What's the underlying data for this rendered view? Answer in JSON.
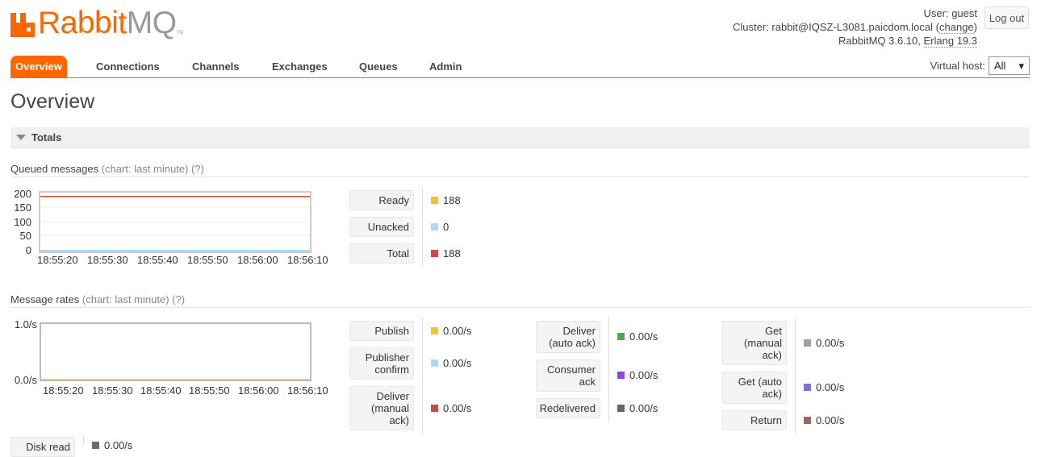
{
  "header": {
    "logo_rabbit": "Rabbit",
    "logo_mq": "MQ",
    "logo_tm": "TM",
    "user_label": "User:",
    "user_name": "guest",
    "cluster_label": "Cluster:",
    "cluster_name": "rabbit@IQSZ-L3081.paicdom.local",
    "cluster_open": "(",
    "cluster_change": "change",
    "cluster_close": ")",
    "rabbitmq_version": "RabbitMQ 3.6.10,",
    "erlang_version": "Erlang 19.3",
    "logout_label": "Log out"
  },
  "nav": {
    "tabs": [
      {
        "label": "Overview",
        "active": true
      },
      {
        "label": "Connections",
        "active": false
      },
      {
        "label": "Channels",
        "active": false
      },
      {
        "label": "Exchanges",
        "active": false
      },
      {
        "label": "Queues",
        "active": false
      },
      {
        "label": "Admin",
        "active": false
      }
    ],
    "vhost_label": "Virtual host:",
    "vhost_value": "All"
  },
  "page_title": "Overview",
  "section": {
    "title": "Totals"
  },
  "queued": {
    "title": "Queued messages",
    "note": "(chart: last minute) (?)",
    "legend": [
      {
        "label": "Ready",
        "value": "188",
        "color": "#edc240"
      },
      {
        "label": "Unacked",
        "value": "0",
        "color": "#afd8f8"
      },
      {
        "label": "Total",
        "value": "188",
        "color": "#cb4b4b"
      }
    ],
    "chart": {
      "y_ticks": [
        "200",
        "150",
        "100",
        "50",
        "0"
      ],
      "x_ticks": [
        "18:55:20",
        "18:55:30",
        "18:55:40",
        "18:55:50",
        "18:56:00",
        "18:56:10"
      ]
    }
  },
  "rates": {
    "title": "Message rates",
    "note": "(chart: last minute) (?)",
    "chart": {
      "y_ticks": [
        "1.0/s",
        "0.0/s"
      ],
      "x_ticks": [
        "18:55:20",
        "18:55:30",
        "18:55:40",
        "18:55:50",
        "18:56:00",
        "18:56:10"
      ]
    },
    "col1": [
      {
        "label": "Publish",
        "value": "0.00/s",
        "color": "#edc240"
      },
      {
        "label": "Publisher confirm",
        "value": "0.00/s",
        "color": "#afd8f8"
      },
      {
        "label": "Deliver (manual ack)",
        "value": "0.00/s",
        "color": "#cb4b4b"
      }
    ],
    "col2": [
      {
        "label": "Deliver (auto ack)",
        "value": "0.00/s",
        "color": "#4da74d"
      },
      {
        "label": "Consumer ack",
        "value": "0.00/s",
        "color": "#9440ed"
      },
      {
        "label": "Redelivered",
        "value": "0.00/s",
        "color": "#666666"
      }
    ],
    "col3": [
      {
        "label": "Get (manual ack)",
        "value": "0.00/s",
        "color": "#a0a0a0"
      },
      {
        "label": "Get (auto ack)",
        "value": "0.00/s",
        "color": "#7878c8"
      },
      {
        "label": "Return",
        "value": "0.00/s",
        "color": "#9c6464"
      }
    ],
    "bottom_partial": {
      "label": "Disk read",
      "value": "0.00/s",
      "color": "#5f6f7a"
    }
  },
  "chart_data": [
    {
      "type": "line",
      "title": "Queued messages",
      "ylim": [
        0,
        200
      ],
      "x": [
        "18:55:20",
        "18:55:30",
        "18:55:40",
        "18:55:50",
        "18:56:00",
        "18:56:10"
      ],
      "series": [
        {
          "name": "Ready",
          "values": [
            188,
            188,
            188,
            188,
            188,
            188
          ]
        },
        {
          "name": "Unacked",
          "values": [
            0,
            0,
            0,
            0,
            0,
            0
          ]
        },
        {
          "name": "Total",
          "values": [
            188,
            188,
            188,
            188,
            188,
            188
          ]
        }
      ]
    },
    {
      "type": "line",
      "title": "Message rates",
      "ylim": [
        0,
        1
      ],
      "x": [
        "18:55:20",
        "18:55:30",
        "18:55:40",
        "18:55:50",
        "18:56:00",
        "18:56:10"
      ],
      "series": [
        {
          "name": "Publish",
          "values": [
            0,
            0,
            0,
            0,
            0,
            0
          ]
        }
      ]
    }
  ]
}
